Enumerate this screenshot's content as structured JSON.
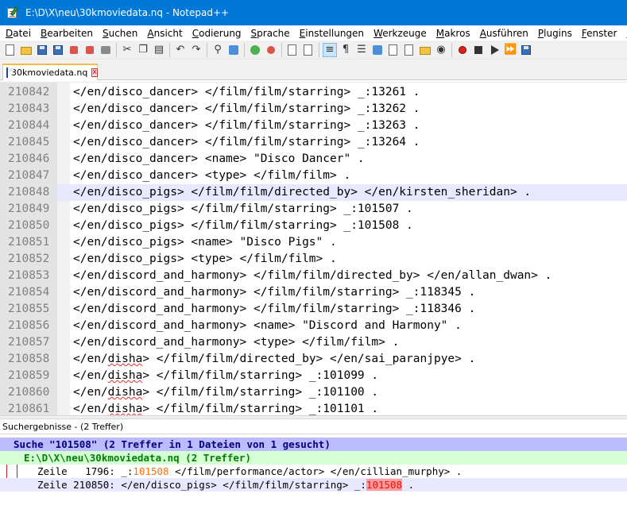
{
  "window": {
    "title": "E:\\D\\X\\neu\\30kmoviedata.nq - Notepad++"
  },
  "menu": {
    "items": [
      {
        "ul": "D",
        "rest": "atei"
      },
      {
        "ul": "B",
        "rest": "earbeiten"
      },
      {
        "ul": "S",
        "rest": "uchen"
      },
      {
        "ul": "A",
        "rest": "nsicht"
      },
      {
        "ul": "C",
        "rest": "odierung"
      },
      {
        "ul": "S",
        "rest": "prache"
      },
      {
        "ul": "E",
        "rest": "instellungen"
      },
      {
        "ul": "W",
        "rest": "erkzeuge"
      },
      {
        "ul": "M",
        "rest": "akros"
      },
      {
        "ul": "A",
        "rest": "usführen"
      },
      {
        "ul": "P",
        "rest": "lugins"
      },
      {
        "ul": "F",
        "rest": "enster"
      },
      {
        "ul": "?",
        "rest": ""
      }
    ]
  },
  "tab": {
    "label": "30kmoviedata.nq",
    "close_glyph": "x"
  },
  "editor": {
    "current_line": "210848",
    "lines": [
      {
        "num": "210842",
        "text": "</en/disco_dancer> </film/film/starring> _:13261 ."
      },
      {
        "num": "210843",
        "text": "</en/disco_dancer> </film/film/starring> _:13262 ."
      },
      {
        "num": "210844",
        "text": "</en/disco_dancer> </film/film/starring> _:13263 ."
      },
      {
        "num": "210845",
        "text": "</en/disco_dancer> </film/film/starring> _:13264 ."
      },
      {
        "num": "210846",
        "text": "</en/disco_dancer> <name> \"Disco Dancer\" ."
      },
      {
        "num": "210847",
        "text": "</en/disco_dancer> <type> </film/film> ."
      },
      {
        "num": "210848",
        "text": "</en/disco_pigs> </film/film/directed_by> </en/kirsten_sheridan> ."
      },
      {
        "num": "210849",
        "text": "</en/disco_pigs> </film/film/starring> _:101507 ."
      },
      {
        "num": "210850",
        "text": "</en/disco_pigs> </film/film/starring> _:101508 ."
      },
      {
        "num": "210851",
        "text": "</en/disco_pigs> <name> \"Disco Pigs\" ."
      },
      {
        "num": "210852",
        "text": "</en/disco_pigs> <type> </film/film> ."
      },
      {
        "num": "210853",
        "text": "</en/discord_and_harmony> </film/film/directed_by> </en/allan_dwan> ."
      },
      {
        "num": "210854",
        "text": "</en/discord_and_harmony> </film/film/starring> _:118345 ."
      },
      {
        "num": "210855",
        "text": "</en/discord_and_harmony> </film/film/starring> _:118346 ."
      },
      {
        "num": "210856",
        "text": "</en/discord_and_harmony> <name> \"Discord and Harmony\" ."
      },
      {
        "num": "210857",
        "text": "</en/discord_and_harmony> <type> </film/film> ."
      },
      {
        "num": "210858",
        "text": "</en/disha> </film/film/directed_by> </en/sai_paranjpye> ."
      },
      {
        "num": "210859",
        "text": "</en/disha> </film/film/starring> _:101099 ."
      },
      {
        "num": "210860",
        "text": "</en/disha> </film/film/starring> _:101100 ."
      },
      {
        "num": "210861",
        "text": "</en/disha> </film/film/starring> _:101101 ."
      }
    ]
  },
  "results_panel": {
    "header": "Suchergebnisse - (2 Treffer)",
    "search_line": "Suche \"101508\" (2 Treffer in 1 Dateien von 1 gesucht)",
    "file_line": "E:\\D\\X\\neu\\30kmoviedata.nq (2 Treffer)",
    "hits": [
      {
        "prefix": "Zeile   1796: _:",
        "match": "101508",
        "suffix": " </film/performance/actor> </en/cillian_murphy> ."
      },
      {
        "prefix": "Zeile 210850: </en/disco_pigs> </film/film/starring> _:",
        "match": "101508",
        "suffix": " ."
      }
    ]
  },
  "colors": {
    "titlebar": "#0078d7",
    "current_line": "#e8e8ff",
    "search_line_bg": "#bbbbff",
    "file_line_bg": "#d5ffd5",
    "match_red": "#e81010",
    "match_orange": "#ff6f0a"
  }
}
